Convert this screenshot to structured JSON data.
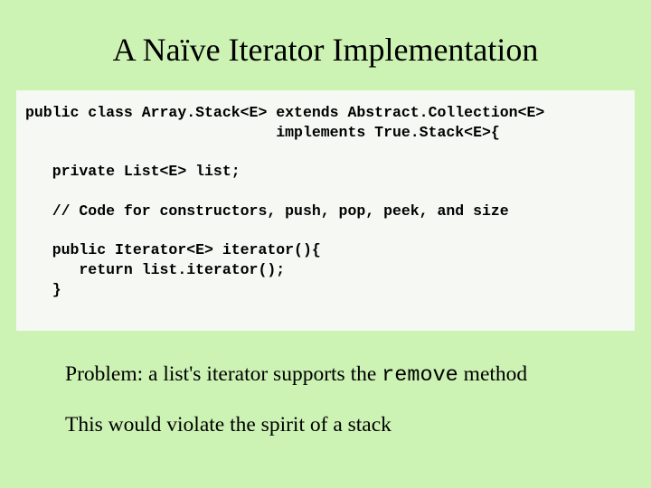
{
  "title": "A Naïve Iterator Implementation",
  "code": {
    "l1": "public class Array.Stack<E> extends Abstract.Collection<E>",
    "l2": "                            implements True.Stack<E>{",
    "l3": "",
    "l4": "   private List<E> list;",
    "l5": "",
    "l6": "   // Code for constructors, push, pop, peek, and size",
    "l7": "",
    "l8": "   public Iterator<E> iterator(){",
    "l9": "      return list.iterator();",
    "l10": "   }"
  },
  "para1_a": "Problem: a list's iterator supports the ",
  "para1_code": "remove",
  "para1_b": " method",
  "para2": "This would violate the spirit of a stack"
}
